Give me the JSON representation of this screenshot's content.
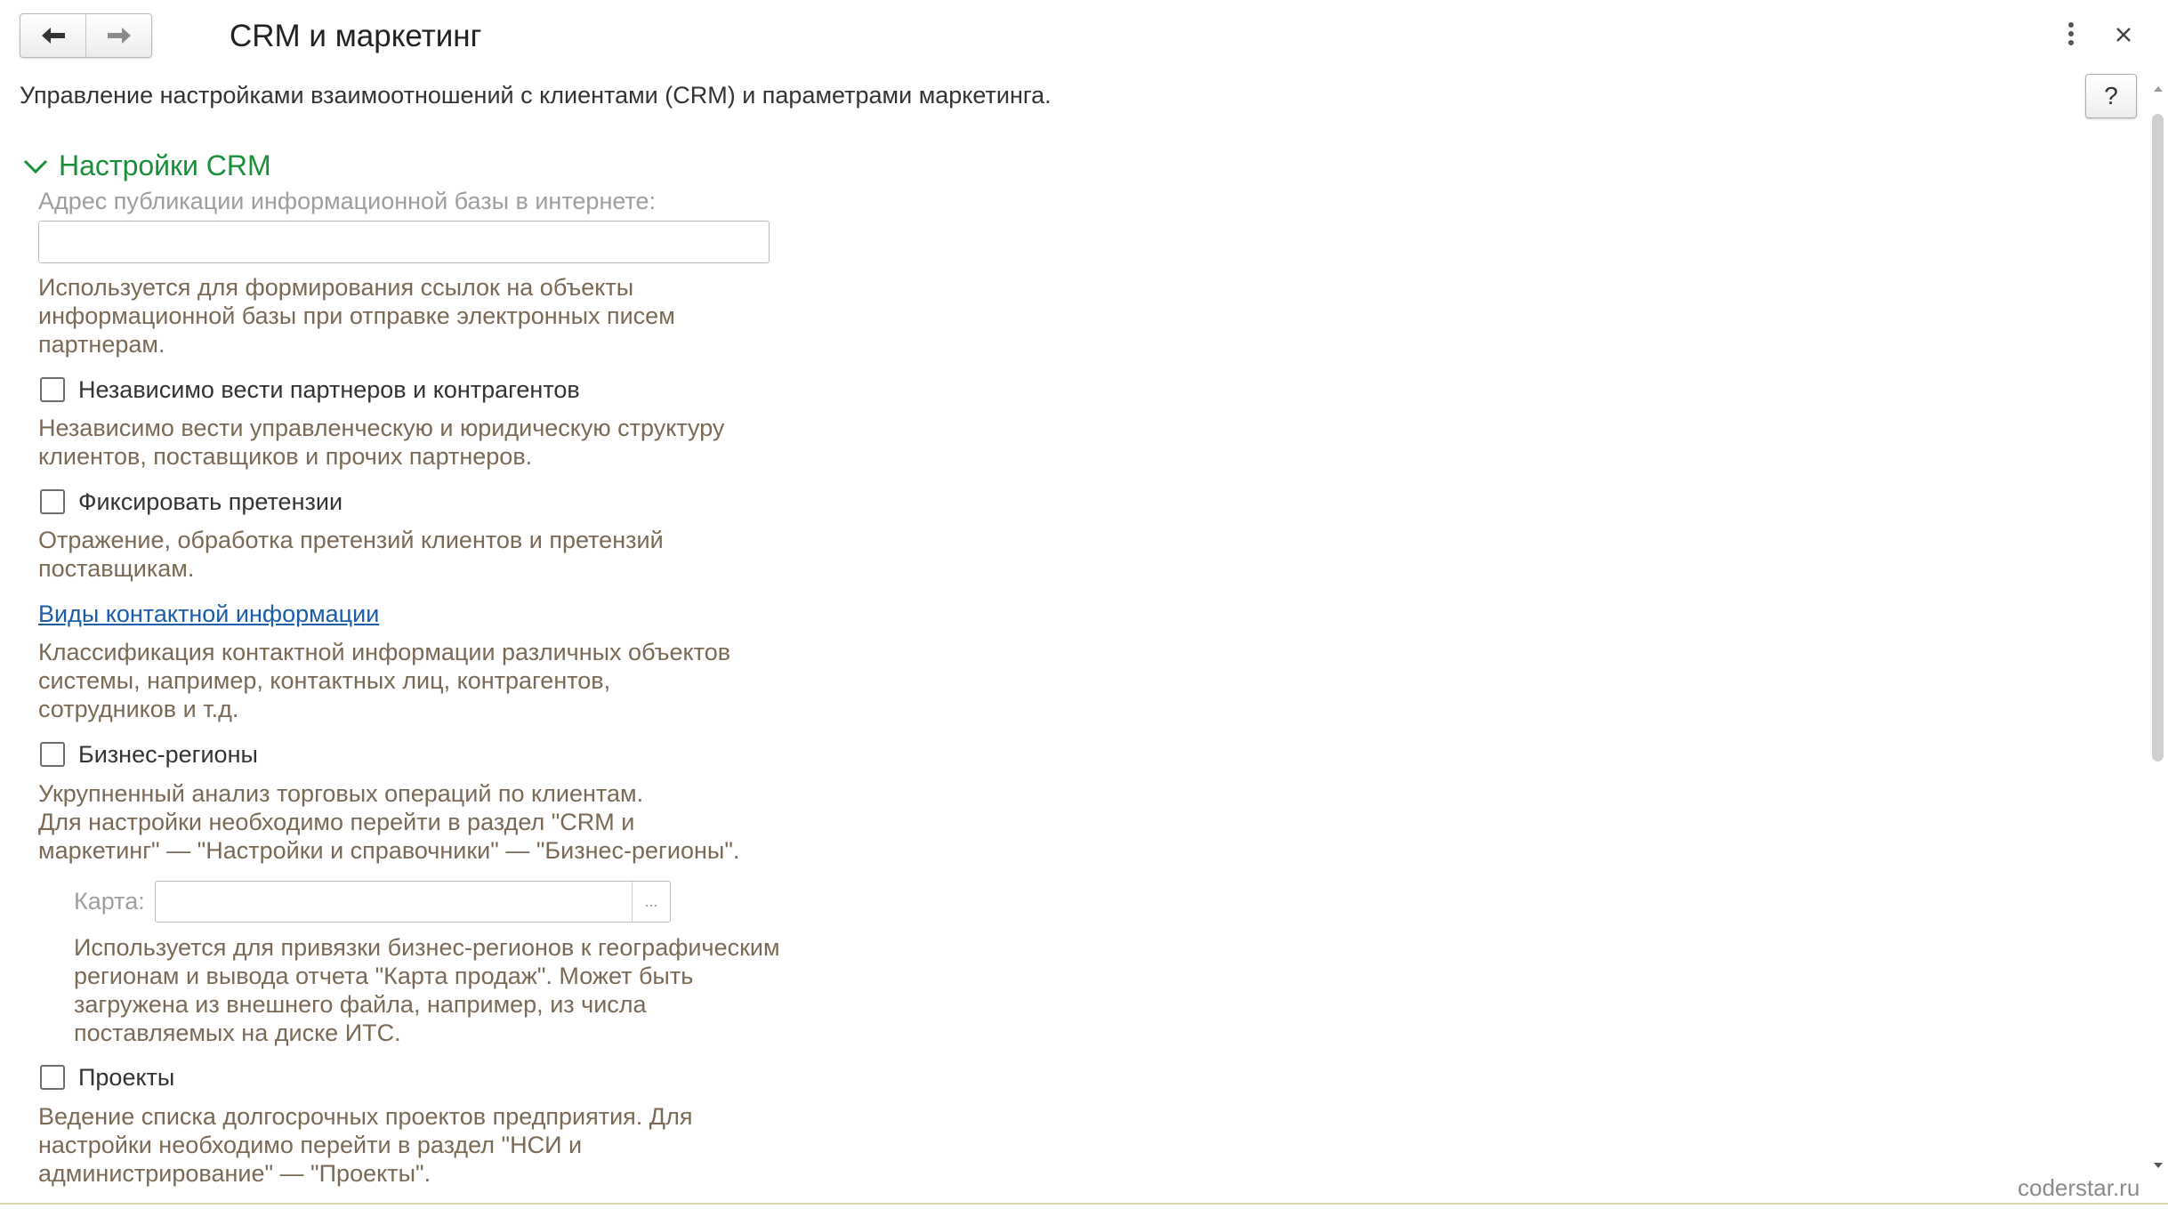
{
  "header": {
    "title": "CRM и маркетинг",
    "back_icon": "arrow-left-icon",
    "forward_icon": "arrow-right-icon",
    "more_icon": "more-vertical-icon",
    "close_icon": "close-icon"
  },
  "intro": {
    "text": "Управление настройками взаимоотношений с клиентами (CRM) и параметрами маркетинга.",
    "help_label": "?"
  },
  "section": {
    "title": "Настройки CRM",
    "expanded": true,
    "address": {
      "label": "Адрес публикации информационной базы в интернете:",
      "value": "",
      "hint_lines": [
        "Используется для формирования ссылок на объекты",
        "информационной базы при отправке электронных писем",
        "партнерам."
      ]
    },
    "independent_partners": {
      "label": "Независимо вести партнеров и контрагентов",
      "checked": false,
      "hint_lines": [
        "Независимо вести управленческую и юридическую структуру",
        "клиентов, поставщиков и прочих партнеров."
      ]
    },
    "claims": {
      "label": "Фиксировать претензии",
      "checked": false,
      "hint_lines": [
        "Отражение, обработка претензий клиентов и претензий",
        "поставщикам."
      ]
    },
    "contact_info": {
      "link": "Виды контактной информации",
      "hint_lines": [
        "Классификация контактной информации различных объектов",
        "системы, например, контактных лиц, контрагентов,",
        "сотрудников и т.д."
      ]
    },
    "business_regions": {
      "label": "Бизнес-регионы",
      "checked": false,
      "hint_lines": [
        "Укрупненный анализ торговых операций по клиентам.",
        "Для настройки необходимо перейти в раздел \"CRM и",
        "маркетинг\" — \"Настройки и справочники\" — \"Бизнес-регионы\"."
      ],
      "map": {
        "label": "Карта:",
        "value": "",
        "select_label": "...",
        "hint_lines": [
          "Используется для привязки бизнес-регионов к географическим",
          "регионам и вывода отчета \"Карта продаж\". Может быть",
          "загружена из внешнего файла, например, из числа",
          "поставляемых на диске ИТС."
        ]
      }
    },
    "projects": {
      "label": "Проекты",
      "checked": false,
      "hint_lines": [
        "Ведение списка долгосрочных проектов предприятия. Для",
        "настройки необходимо перейти в раздел \"НСИ и",
        "администрирование\" — \"Проекты\"."
      ]
    }
  },
  "watermark": "coderstar.ru",
  "colors": {
    "section_title": "#1a8f3a",
    "hint": "#7a6a55",
    "link": "#1b5dab",
    "label_disabled": "#9e9e9e"
  }
}
